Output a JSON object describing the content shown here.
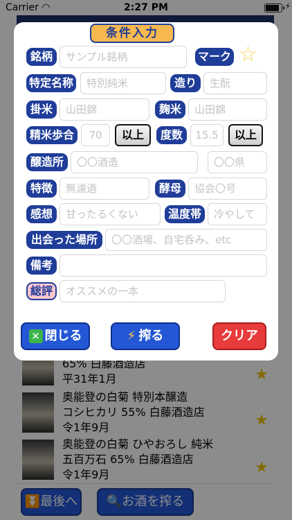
{
  "status": {
    "carrier": "Carrier",
    "time": "2:27 PM",
    "battery_level": 0.95
  },
  "modal": {
    "title": "条件入力",
    "labels": {
      "brand": "銘柄",
      "mark": "マーク",
      "special": "特定名称",
      "brewing": "造り",
      "kakemai": "掛米",
      "koujimai": "麹米",
      "polish": "精米歩合",
      "ijo1": "以上",
      "alcohol": "度数",
      "ijo2": "以上",
      "brewery": "醸造所",
      "feature": "特徴",
      "yeast": "酵母",
      "impression": "感想",
      "temperature": "温度帯",
      "place": "出会った場所",
      "note": "備考",
      "review": "総評"
    },
    "placeholders": {
      "brand": "サンプル銘柄",
      "special": "特別純米",
      "brewing": "生酛",
      "kakemai": "山田錦",
      "koujimai": "山田錦",
      "polish": "70",
      "alcohol": "15.5",
      "brewery": "〇〇酒造",
      "prefecture": "〇〇県",
      "feature": "無濾過",
      "yeast": "協会〇号",
      "impression": "甘ったるくない",
      "temperature": "冷やして",
      "place": "〇〇酒場、自宅呑み、etc",
      "note": "",
      "review": "オススメの一本"
    },
    "buttons": {
      "close": "閉じる",
      "squeeze": "搾る",
      "clear": "クリア"
    }
  },
  "list": [
    {
      "lines": [
        "65% 白藤酒造店",
        "平31年1月"
      ]
    },
    {
      "lines": [
        "奥能登の白菊 特別本醸造",
        "コシヒカリ 55% 白藤酒造店",
        "令1年9月"
      ]
    },
    {
      "lines": [
        "奥能登の白菊 ひやおろし 純米",
        "五百万石 65% 白藤酒造店",
        "令1年9月"
      ]
    }
  ],
  "bottom": {
    "last": "最後へ",
    "search": "お酒を搾る"
  }
}
